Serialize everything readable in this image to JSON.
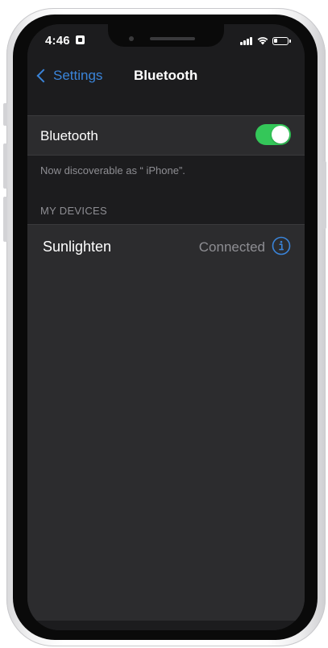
{
  "status_bar": {
    "time": "4:46",
    "icons": [
      "lock-icon",
      "signal-icon",
      "wifi-icon",
      "battery-icon"
    ]
  },
  "nav": {
    "back_label": "Settings",
    "title": "Bluetooth"
  },
  "bluetooth_row": {
    "label": "Bluetooth",
    "enabled": true
  },
  "discoverable_text": "Now discoverable as “ iPhone”.",
  "my_devices": {
    "header": "MY DEVICES",
    "items": [
      {
        "name": "Sunlighten",
        "status": "Connected"
      }
    ]
  },
  "colors": {
    "accent": "#3a84d9",
    "toggle_on": "#34c759",
    "background": "#1c1c1e",
    "cell": "#2c2c2e",
    "secondary_text": "#8e8e93"
  }
}
